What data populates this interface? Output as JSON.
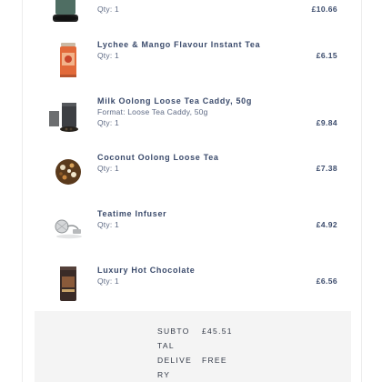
{
  "order": {
    "items": [
      {
        "name": "",
        "detail_lines": [
          "Qty: 1"
        ],
        "price": "£10.66",
        "icon": "tea-caddy-green-icon"
      },
      {
        "name": "Lychee & Mango Flavour Instant Tea",
        "detail_lines": [
          "Qty: 1"
        ],
        "price": "£6.15",
        "icon": "tea-tin-orange-icon"
      },
      {
        "name": "Milk Oolong Loose Tea Caddy, 50g",
        "detail_lines": [
          "Format: Loose Tea Caddy, 50g",
          "Qty: 1"
        ],
        "price": "£9.84",
        "icon": "tea-caddy-set-icon"
      },
      {
        "name": "Coconut Oolong Loose Tea",
        "detail_lines": [
          "Qty: 1"
        ],
        "price": "£7.38",
        "icon": "loose-tea-pile-icon"
      },
      {
        "name": "Teatime Infuser",
        "detail_lines": [
          "Qty: 1"
        ],
        "price": "£4.92",
        "icon": "tea-infuser-icon"
      },
      {
        "name": "Luxury Hot Chocolate",
        "detail_lines": [
          "Qty: 1"
        ],
        "price": "£6.56",
        "icon": "hot-chocolate-tin-icon"
      }
    ]
  },
  "summary": {
    "subtotal_label": "SUBTOTAL",
    "subtotal_value": "£45.51",
    "delivery_label": "DELIVERY",
    "delivery_value": "FREE"
  }
}
